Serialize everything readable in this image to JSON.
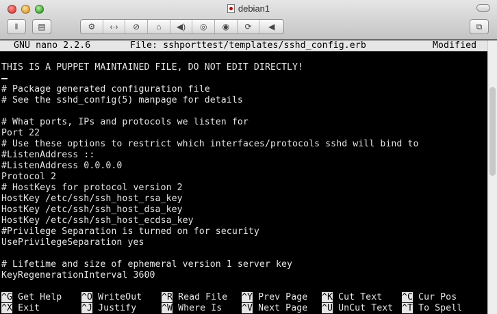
{
  "window": {
    "title": "debian1"
  },
  "toolbar": {
    "pause_glyph": "‖",
    "snapshot_glyph": "▤",
    "wrench_glyph": "⚙",
    "network_glyph": "‹·›",
    "disk_glyph": "⊘",
    "printer_glyph": "⌂",
    "sound_glyph": "◀)",
    "cd_glyph": "◎",
    "camera_glyph": "◉",
    "usb_glyph": "⟳",
    "arrow_glyph": "◀",
    "fullscreen_glyph": "⧉"
  },
  "nano": {
    "version": "GNU nano 2.2.6",
    "file": "File: sshporttest/templates/sshd_config.erb",
    "status": "Modified"
  },
  "lines": [
    "",
    "THIS IS A PUPPET MAINTAINED FILE, DO NOT EDIT DIRECTLY!",
    "",
    "# Package generated configuration file",
    "# See the sshd_config(5) manpage for details",
    "",
    "# What ports, IPs and protocols we listen for",
    "Port 22",
    "# Use these options to restrict which interfaces/protocols sshd will bind to",
    "#ListenAddress ::",
    "#ListenAddress 0.0.0.0",
    "Protocol 2",
    "# HostKeys for protocol version 2",
    "HostKey /etc/ssh/ssh_host_rsa_key",
    "HostKey /etc/ssh/ssh_host_dsa_key",
    "HostKey /etc/ssh/ssh_host_ecdsa_key",
    "#Privilege Separation is turned on for security",
    "UsePrivilegeSeparation yes",
    "",
    "# Lifetime and size of ephemeral version 1 server key",
    "KeyRegenerationInterval 3600"
  ],
  "shortcuts": [
    [
      {
        "key": "^G",
        "label": "Get Help"
      },
      {
        "key": "^O",
        "label": "WriteOut"
      },
      {
        "key": "^R",
        "label": "Read File"
      },
      {
        "key": "^Y",
        "label": "Prev Page"
      },
      {
        "key": "^K",
        "label": "Cut Text"
      },
      {
        "key": "^C",
        "label": "Cur Pos"
      }
    ],
    [
      {
        "key": "^X",
        "label": "Exit"
      },
      {
        "key": "^J",
        "label": "Justify"
      },
      {
        "key": "^W",
        "label": "Where Is"
      },
      {
        "key": "^V",
        "label": "Next Page"
      },
      {
        "key": "^U",
        "label": "UnCut Text"
      },
      {
        "key": "^T",
        "label": "To Spell"
      }
    ]
  ]
}
